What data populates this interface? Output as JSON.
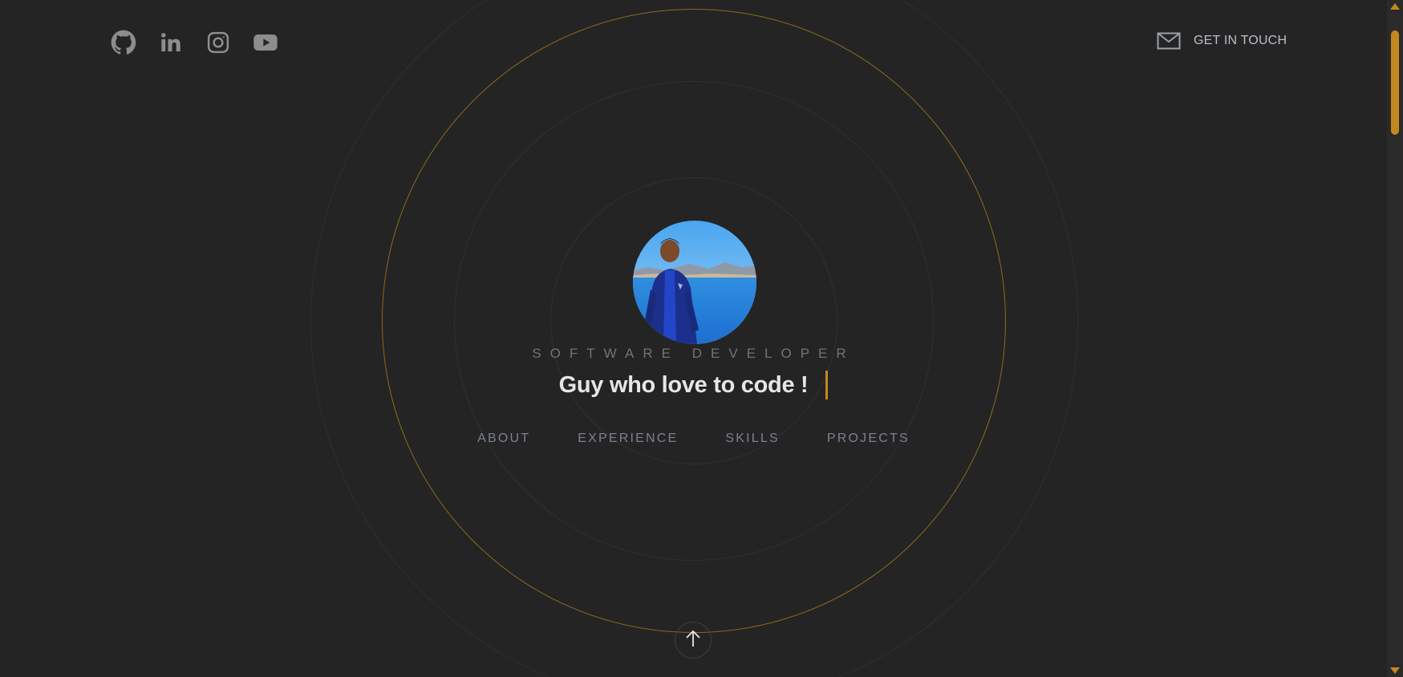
{
  "social": {
    "items": [
      {
        "icon": "github-icon"
      },
      {
        "icon": "linkedin-icon"
      },
      {
        "icon": "instagram-icon"
      },
      {
        "icon": "youtube-icon"
      }
    ]
  },
  "header": {
    "contact_label": "GET IN TOUCH",
    "contact_icon": "mail-icon"
  },
  "hero": {
    "role": "SOFTWARE DEVELOPER",
    "headline": "Guy who love to code !"
  },
  "nav": {
    "items": [
      {
        "label": "ABOUT"
      },
      {
        "label": "EXPERIENCE"
      },
      {
        "label": "SKILLS"
      },
      {
        "label": "PROJECTS"
      }
    ]
  },
  "scroll_button": {
    "icon": "arrow-up-icon"
  },
  "colors": {
    "background": "#242424",
    "accent": "#c4891e",
    "muted_text": "#7b8190"
  }
}
